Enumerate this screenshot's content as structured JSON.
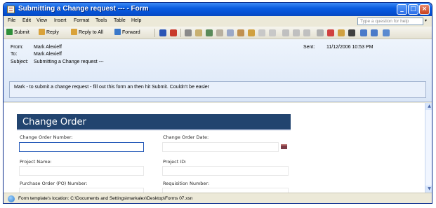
{
  "window": {
    "title": "Submitting a Change request --- - Form"
  },
  "menu": [
    "File",
    "Edit",
    "View",
    "Insert",
    "Format",
    "Tools",
    "Table",
    "Help"
  ],
  "ask_placeholder": "Type a question for help",
  "toolbar": {
    "submit": "Submit",
    "reply": "Reply",
    "reply_all": "Reply to All",
    "forward": "Forward"
  },
  "header": {
    "from_label": "From:",
    "from_value": "Mark Alexieff",
    "to_label": "To:",
    "to_value": "Mark Alexieff",
    "subject_label": "Subject:",
    "subject_value": "Submitting a Change request ---",
    "sent_label": "Sent:",
    "sent_value": "11/12/2006 10:53 PM"
  },
  "body_text": "Mark - to submit a change request - fill out this form an then hit Submit.  Couldn't be easier",
  "form": {
    "title": "Change Order",
    "change_order_number": "Change Order Number:",
    "change_order_date": "Change Order Date:",
    "project_name": "Project Name:",
    "project_id": "Project ID:",
    "po_number": "Purchase Order (PO) Number:",
    "requisition_number": "Requisition Number:"
  },
  "status": "Form template's location: C:\\Documents and Settings\\markalex\\Desktop\\Forms 07.xsn"
}
